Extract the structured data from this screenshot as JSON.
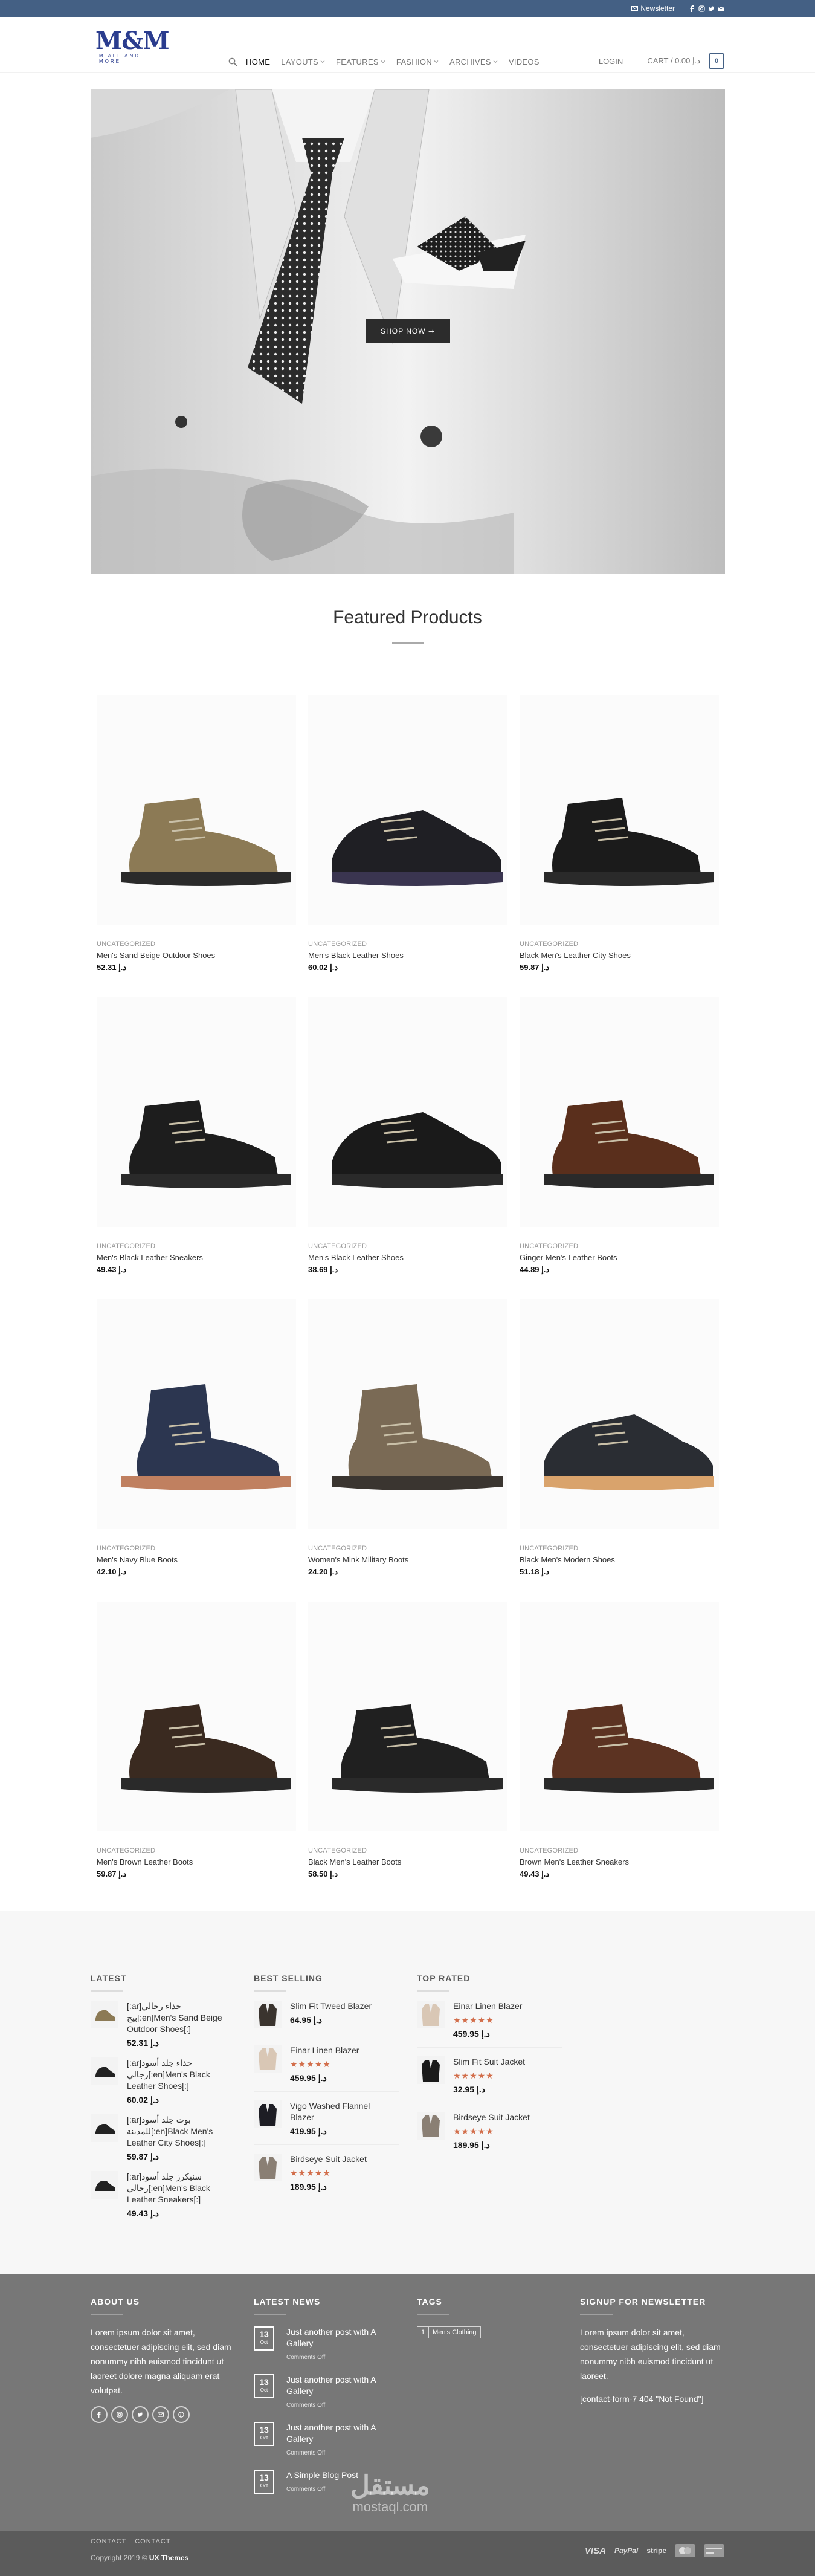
{
  "topbar": {
    "newsletter": "Newsletter",
    "icons": [
      "facebook-icon",
      "instagram-icon",
      "twitter-icon",
      "mail-icon"
    ]
  },
  "header": {
    "logo_big": "M&M",
    "logo_small": "M ALL AND MORE",
    "nav": [
      {
        "label": "HOME",
        "active": true,
        "dropdown": false
      },
      {
        "label": "LAYOUTS",
        "active": false,
        "dropdown": true
      },
      {
        "label": "FEATURES",
        "active": false,
        "dropdown": true
      },
      {
        "label": "FASHION",
        "active": false,
        "dropdown": true
      },
      {
        "label": "ARCHIVES",
        "active": false,
        "dropdown": true
      },
      {
        "label": "VIDEOS",
        "active": false,
        "dropdown": false
      }
    ],
    "login": "LOGIN",
    "cart": "CART / 0.00 د.إ",
    "cart_count": "0"
  },
  "hero": {
    "button": "SHOP NOW ➞"
  },
  "featured": {
    "title": "Featured Products",
    "products": [
      {
        "category": "UNCATEGORIZED",
        "name": "Men's Sand Beige Outdoor Shoes",
        "price": "52.31 د.إ"
      },
      {
        "category": "UNCATEGORIZED",
        "name": "Men's Black Leather Shoes",
        "price": "60.02 د.إ"
      },
      {
        "category": "UNCATEGORIZED",
        "name": "Black Men's Leather City Shoes",
        "price": "59.87 د.إ"
      },
      {
        "category": "UNCATEGORIZED",
        "name": "Men's Black Leather Sneakers",
        "price": "49.43 د.إ"
      },
      {
        "category": "UNCATEGORIZED",
        "name": "Men's Black Leather Shoes",
        "price": "38.69 د.إ"
      },
      {
        "category": "UNCATEGORIZED",
        "name": "Ginger Men's Leather Boots",
        "price": "44.89 د.إ"
      },
      {
        "category": "UNCATEGORIZED",
        "name": "Men's Navy Blue Boots",
        "price": "42.10 د.إ"
      },
      {
        "category": "UNCATEGORIZED",
        "name": "Women's Mink Military Boots",
        "price": "24.20 د.إ"
      },
      {
        "category": "UNCATEGORIZED",
        "name": "Black Men's Modern Shoes",
        "price": "51.18 د.إ"
      },
      {
        "category": "UNCATEGORIZED",
        "name": "Men's Brown Leather Boots",
        "price": "59.87 د.إ"
      },
      {
        "category": "UNCATEGORIZED",
        "name": "Black Men's Leather Boots",
        "price": "58.50 د.إ"
      },
      {
        "category": "UNCATEGORIZED",
        "name": "Brown Men's Leather Sneakers",
        "price": "49.43 د.إ"
      }
    ]
  },
  "widgets": {
    "latest": {
      "title": "LATEST",
      "items": [
        {
          "name": "[:ar]حذاء رجالي بيج[:en]Men's Sand Beige Outdoor Shoes[:]",
          "price": "52.31 د.إ"
        },
        {
          "name": "[:ar]حذاء جلد أسود رجالي[:en]Men's Black Leather Shoes[:]",
          "price": "60.02 د.إ"
        },
        {
          "name": "[:ar]بوت جلد أسود للمدينة[:en]Black Men's Leather City Shoes[:]",
          "price": "59.87 د.إ"
        },
        {
          "name": "[:ar]سنيكرز جلد أسود رجالي[:en]Men's Black Leather Sneakers[:]",
          "price": "49.43 د.إ"
        }
      ]
    },
    "best_selling": {
      "title": "BEST SELLING",
      "items": [
        {
          "name": "Slim Fit Tweed Blazer",
          "price": "64.95 د.إ",
          "rated": false
        },
        {
          "name": "Einar Linen Blazer",
          "price": "459.95 د.إ",
          "rated": true
        },
        {
          "name": "Vigo Washed Flannel Blazer",
          "price": "419.95 د.إ",
          "rated": false
        },
        {
          "name": "Birdseye Suit Jacket",
          "price": "189.95 د.إ",
          "rated": true
        }
      ]
    },
    "top_rated": {
      "title": "TOP RATED",
      "items": [
        {
          "name": "Einar Linen Blazer",
          "price": "459.95 د.إ"
        },
        {
          "name": "Slim Fit Suit Jacket",
          "price": "32.95 د.إ"
        },
        {
          "name": "Birdseye Suit Jacket",
          "price": "189.95 د.إ"
        }
      ]
    },
    "stars": "★★★★★"
  },
  "footer": {
    "about": {
      "title": "ABOUT US",
      "text": "Lorem ipsum dolor sit amet, consectetuer adipiscing elit, sed diam nonummy nibh euismod tincidunt ut laoreet dolore magna aliquam erat volutpat."
    },
    "news": {
      "title": "LATEST NEWS",
      "posts": [
        {
          "day": "13",
          "month": "Oct",
          "title": "Just another post with A Gallery",
          "comments": "Comments Off"
        },
        {
          "day": "13",
          "month": "Oct",
          "title": "Just another post with A Gallery",
          "comments": "Comments Off"
        },
        {
          "day": "13",
          "month": "Oct",
          "title": "Just another post with A Gallery",
          "comments": "Comments Off"
        },
        {
          "day": "13",
          "month": "Oct",
          "title": "A Simple Blog Post",
          "comments": "Comments Off"
        }
      ]
    },
    "tags": {
      "title": "TAGS",
      "count": "1",
      "tag": "Men's Clothing"
    },
    "signup": {
      "title": "SIGNUP FOR NEWSLETTER",
      "text": "Lorem ipsum dolor sit amet, consectetuer adipiscing elit, sed diam nonummy nibh euismod tincidunt ut laoreet.",
      "form": "[contact-form-7 404 \"Not Found\"]"
    },
    "links": [
      "CONTACT",
      "CONTACT"
    ],
    "copyright_prefix": "Copyright 2019 © ",
    "copyright_brand": "UX Themes",
    "payments": [
      "VISA",
      "PayPal",
      "stripe",
      "mastercard",
      "card"
    ],
    "watermark": "مستقل",
    "watermark_sub": "mostaql.com"
  }
}
